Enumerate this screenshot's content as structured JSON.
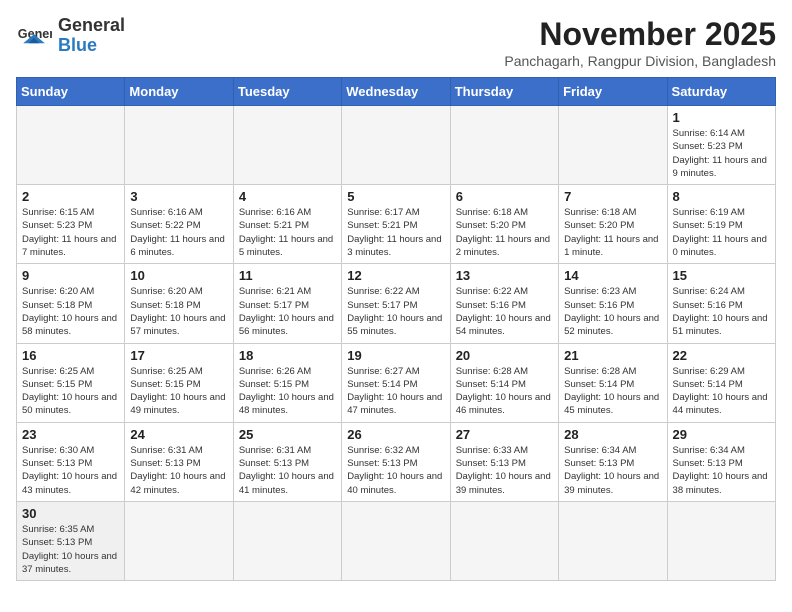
{
  "header": {
    "logo_general": "General",
    "logo_blue": "Blue",
    "title": "November 2025",
    "subtitle": "Panchagarh, Rangpur Division, Bangladesh"
  },
  "weekdays": [
    "Sunday",
    "Monday",
    "Tuesday",
    "Wednesday",
    "Thursday",
    "Friday",
    "Saturday"
  ],
  "weeks": [
    [
      {
        "day": "",
        "info": ""
      },
      {
        "day": "",
        "info": ""
      },
      {
        "day": "",
        "info": ""
      },
      {
        "day": "",
        "info": ""
      },
      {
        "day": "",
        "info": ""
      },
      {
        "day": "",
        "info": ""
      },
      {
        "day": "1",
        "info": "Sunrise: 6:14 AM\nSunset: 5:23 PM\nDaylight: 11 hours and 9 minutes."
      }
    ],
    [
      {
        "day": "2",
        "info": "Sunrise: 6:15 AM\nSunset: 5:23 PM\nDaylight: 11 hours and 7 minutes."
      },
      {
        "day": "3",
        "info": "Sunrise: 6:16 AM\nSunset: 5:22 PM\nDaylight: 11 hours and 6 minutes."
      },
      {
        "day": "4",
        "info": "Sunrise: 6:16 AM\nSunset: 5:21 PM\nDaylight: 11 hours and 5 minutes."
      },
      {
        "day": "5",
        "info": "Sunrise: 6:17 AM\nSunset: 5:21 PM\nDaylight: 11 hours and 3 minutes."
      },
      {
        "day": "6",
        "info": "Sunrise: 6:18 AM\nSunset: 5:20 PM\nDaylight: 11 hours and 2 minutes."
      },
      {
        "day": "7",
        "info": "Sunrise: 6:18 AM\nSunset: 5:20 PM\nDaylight: 11 hours and 1 minute."
      },
      {
        "day": "8",
        "info": "Sunrise: 6:19 AM\nSunset: 5:19 PM\nDaylight: 11 hours and 0 minutes."
      }
    ],
    [
      {
        "day": "9",
        "info": "Sunrise: 6:20 AM\nSunset: 5:18 PM\nDaylight: 10 hours and 58 minutes."
      },
      {
        "day": "10",
        "info": "Sunrise: 6:20 AM\nSunset: 5:18 PM\nDaylight: 10 hours and 57 minutes."
      },
      {
        "day": "11",
        "info": "Sunrise: 6:21 AM\nSunset: 5:17 PM\nDaylight: 10 hours and 56 minutes."
      },
      {
        "day": "12",
        "info": "Sunrise: 6:22 AM\nSunset: 5:17 PM\nDaylight: 10 hours and 55 minutes."
      },
      {
        "day": "13",
        "info": "Sunrise: 6:22 AM\nSunset: 5:16 PM\nDaylight: 10 hours and 54 minutes."
      },
      {
        "day": "14",
        "info": "Sunrise: 6:23 AM\nSunset: 5:16 PM\nDaylight: 10 hours and 52 minutes."
      },
      {
        "day": "15",
        "info": "Sunrise: 6:24 AM\nSunset: 5:16 PM\nDaylight: 10 hours and 51 minutes."
      }
    ],
    [
      {
        "day": "16",
        "info": "Sunrise: 6:25 AM\nSunset: 5:15 PM\nDaylight: 10 hours and 50 minutes."
      },
      {
        "day": "17",
        "info": "Sunrise: 6:25 AM\nSunset: 5:15 PM\nDaylight: 10 hours and 49 minutes."
      },
      {
        "day": "18",
        "info": "Sunrise: 6:26 AM\nSunset: 5:15 PM\nDaylight: 10 hours and 48 minutes."
      },
      {
        "day": "19",
        "info": "Sunrise: 6:27 AM\nSunset: 5:14 PM\nDaylight: 10 hours and 47 minutes."
      },
      {
        "day": "20",
        "info": "Sunrise: 6:28 AM\nSunset: 5:14 PM\nDaylight: 10 hours and 46 minutes."
      },
      {
        "day": "21",
        "info": "Sunrise: 6:28 AM\nSunset: 5:14 PM\nDaylight: 10 hours and 45 minutes."
      },
      {
        "day": "22",
        "info": "Sunrise: 6:29 AM\nSunset: 5:14 PM\nDaylight: 10 hours and 44 minutes."
      }
    ],
    [
      {
        "day": "23",
        "info": "Sunrise: 6:30 AM\nSunset: 5:13 PM\nDaylight: 10 hours and 43 minutes."
      },
      {
        "day": "24",
        "info": "Sunrise: 6:31 AM\nSunset: 5:13 PM\nDaylight: 10 hours and 42 minutes."
      },
      {
        "day": "25",
        "info": "Sunrise: 6:31 AM\nSunset: 5:13 PM\nDaylight: 10 hours and 41 minutes."
      },
      {
        "day": "26",
        "info": "Sunrise: 6:32 AM\nSunset: 5:13 PM\nDaylight: 10 hours and 40 minutes."
      },
      {
        "day": "27",
        "info": "Sunrise: 6:33 AM\nSunset: 5:13 PM\nDaylight: 10 hours and 39 minutes."
      },
      {
        "day": "28",
        "info": "Sunrise: 6:34 AM\nSunset: 5:13 PM\nDaylight: 10 hours and 39 minutes."
      },
      {
        "day": "29",
        "info": "Sunrise: 6:34 AM\nSunset: 5:13 PM\nDaylight: 10 hours and 38 minutes."
      }
    ],
    [
      {
        "day": "30",
        "info": "Sunrise: 6:35 AM\nSunset: 5:13 PM\nDaylight: 10 hours and 37 minutes."
      },
      {
        "day": "",
        "info": ""
      },
      {
        "day": "",
        "info": ""
      },
      {
        "day": "",
        "info": ""
      },
      {
        "day": "",
        "info": ""
      },
      {
        "day": "",
        "info": ""
      },
      {
        "day": "",
        "info": ""
      }
    ]
  ]
}
